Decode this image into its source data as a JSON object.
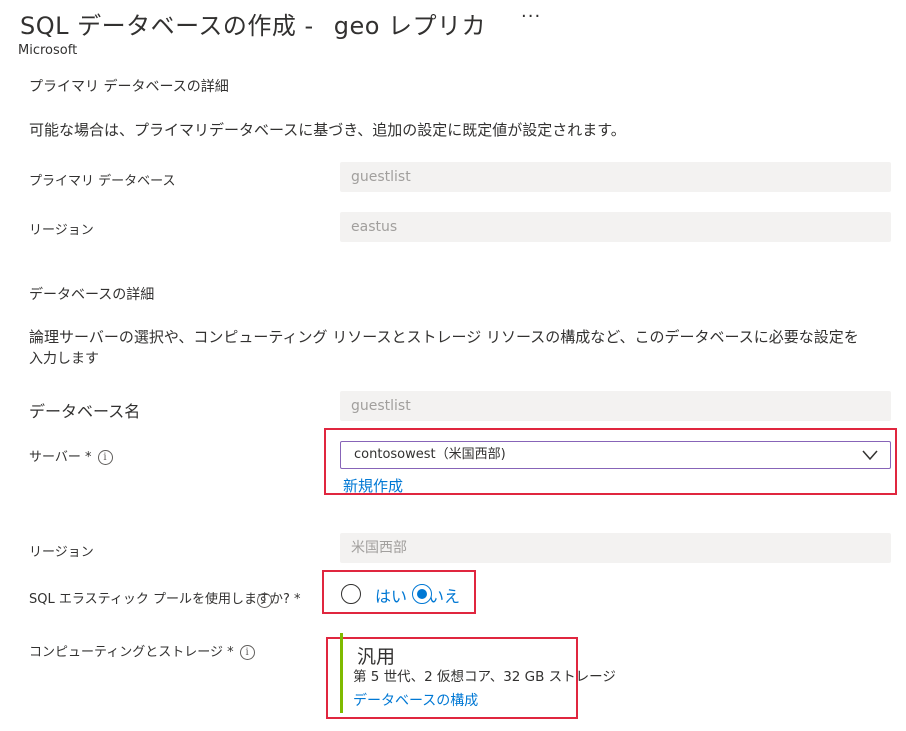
{
  "header": {
    "title_main": "SQL データベースの作成 -",
    "title_geo": "geo レプリカ",
    "more": "···",
    "publisher": "Microsoft"
  },
  "primary": {
    "section_title": "プライマリ データベースの詳細",
    "description": "可能な場合は、プライマリデータベースに基づき、追加の設定に既定値が設定されます。",
    "db_label": "プライマリ データベース",
    "db_value": "guestlist",
    "region_label": "リージョン",
    "region_value": "eastus"
  },
  "database": {
    "section_title": "データベースの詳細",
    "description_line1": "論理サーバーの選択や、コンピューティング リソースとストレージ リソースの構成など、このデータベースに必要な設定を",
    "description_line2": "入力します",
    "name_label": "データベース名",
    "name_value": "guestlist",
    "server_label": "サーバー *",
    "server_value": "contosowest（米国西部)",
    "create_new": "新規作成",
    "region_label": "リージョン",
    "region_value": "米国西部",
    "elastic_label": "SQL エラスティック プールを使用しますか? *",
    "elastic_yes": "はい",
    "elastic_no": "いいえ",
    "elastic_selected": "いいえ",
    "compute_label": "コンピューティングとストレージ *",
    "compute_tier": "汎用",
    "compute_detail": "第 5 世代、2 仮想コア、32 GB ストレージ",
    "configure_link": "データベースの構成"
  },
  "colors": {
    "highlight": "#e0263f",
    "accent": "#0078d4",
    "tier_bar": "#7fba00",
    "readonly_bg": "#f3f2f1"
  }
}
